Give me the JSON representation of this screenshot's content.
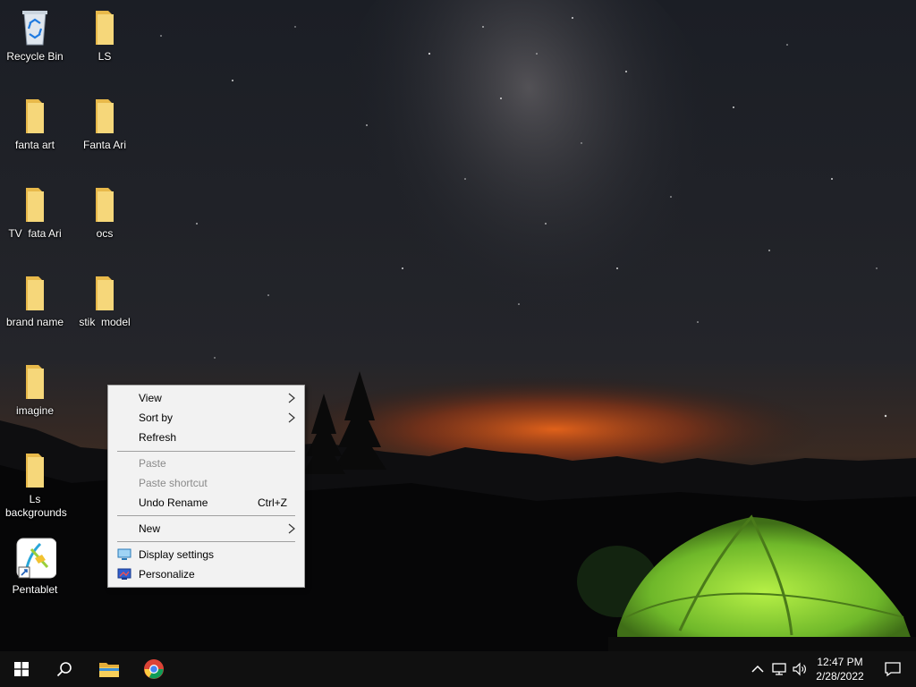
{
  "desktop": {
    "icons": [
      {
        "label": "Recycle Bin",
        "icon": "recycle-bin-icon"
      },
      {
        "label": "LS",
        "icon": "folder-icon"
      },
      {
        "label": "fanta art",
        "icon": "folder-icon"
      },
      {
        "label": "Fanta Ari",
        "icon": "folder-icon"
      },
      {
        "label": "TV  fata Ari",
        "icon": "folder-icon"
      },
      {
        "label": "ocs",
        "icon": "folder-icon"
      },
      {
        "label": "brand name",
        "icon": "folder-icon"
      },
      {
        "label": "stik  model",
        "icon": "folder-icon"
      },
      {
        "label": "imagine",
        "icon": "folder-icon"
      },
      {
        "label": "Ls backgrounds",
        "icon": "folder-icon"
      },
      {
        "label": "Pentablet",
        "icon": "pentablet-app-icon"
      }
    ]
  },
  "context_menu": {
    "view": "View",
    "sort_by": "Sort by",
    "refresh": "Refresh",
    "paste": "Paste",
    "paste_shortcut": "Paste shortcut",
    "undo_rename": "Undo Rename",
    "undo_rename_shortcut": "Ctrl+Z",
    "new": "New",
    "display_settings": "Display settings",
    "personalize": "Personalize"
  },
  "taskbar": {
    "time": "12:47 PM",
    "date": "2/28/2022",
    "pinned": [
      "windows-start-icon",
      "search-icon",
      "file-explorer-icon",
      "chrome-icon"
    ],
    "tray": [
      "chevron-up-icon",
      "network-icon",
      "volume-icon",
      "notification-icon"
    ]
  },
  "colors": {
    "taskbar": "#101010",
    "menu_bg": "#f2f2f2",
    "folder_yellow": "#f3d36b",
    "tent_green": "#8fd13a"
  }
}
